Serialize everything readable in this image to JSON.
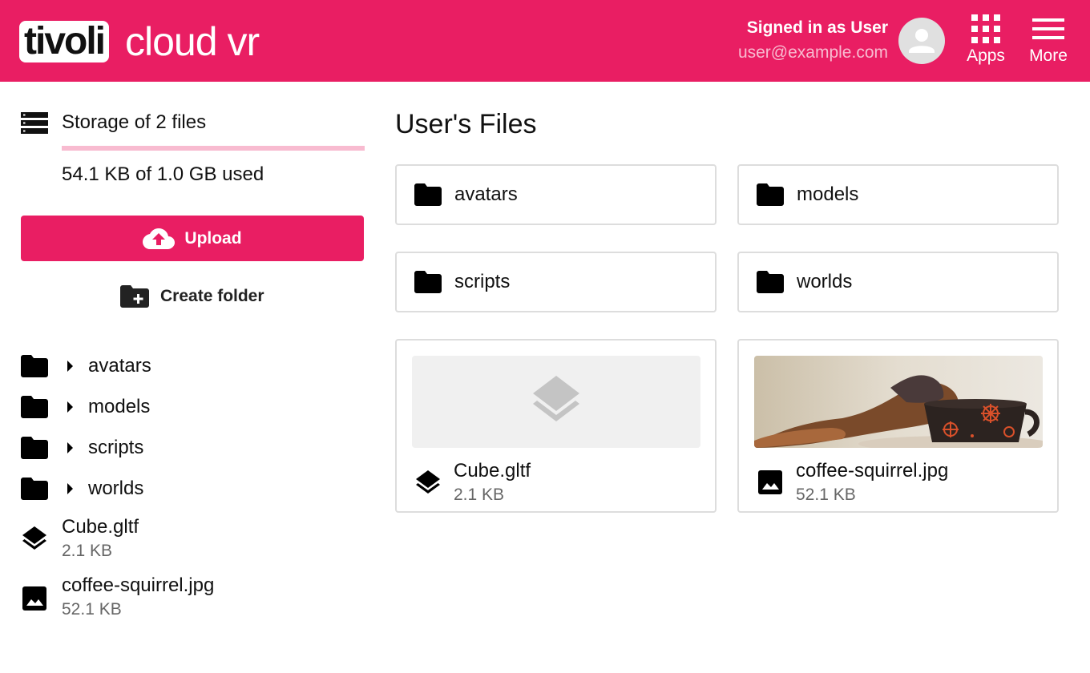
{
  "header": {
    "logo_word": "tivoli",
    "logo_rest": "cloud vr",
    "signed_in_text": "Signed in as User",
    "email": "user@example.com",
    "apps_label": "Apps",
    "more_label": "More"
  },
  "colors": {
    "brand": "#e91e63",
    "brand_light": "#f8bbd0"
  },
  "sidebar": {
    "storage_title": "Storage of 2 files",
    "storage_used_text": "54.1 KB of 1.0 GB used",
    "storage_fraction": 0.0001,
    "upload_label": "Upload",
    "create_folder_label": "Create folder",
    "folders": [
      {
        "name": "avatars"
      },
      {
        "name": "models"
      },
      {
        "name": "scripts"
      },
      {
        "name": "worlds"
      }
    ],
    "files": [
      {
        "name": "Cube.gltf",
        "size": "2.1 KB",
        "icon": "layers-icon"
      },
      {
        "name": "coffee-squirrel.jpg",
        "size": "52.1 KB",
        "icon": "image-icon"
      }
    ]
  },
  "main": {
    "title": "User's Files",
    "folders": [
      {
        "name": "avatars"
      },
      {
        "name": "models"
      },
      {
        "name": "scripts"
      },
      {
        "name": "worlds"
      }
    ],
    "files": [
      {
        "name": "Cube.gltf",
        "size": "2.1 KB",
        "icon": "layers-icon"
      },
      {
        "name": "coffee-squirrel.jpg",
        "size": "52.1 KB",
        "icon": "image-icon"
      }
    ]
  }
}
